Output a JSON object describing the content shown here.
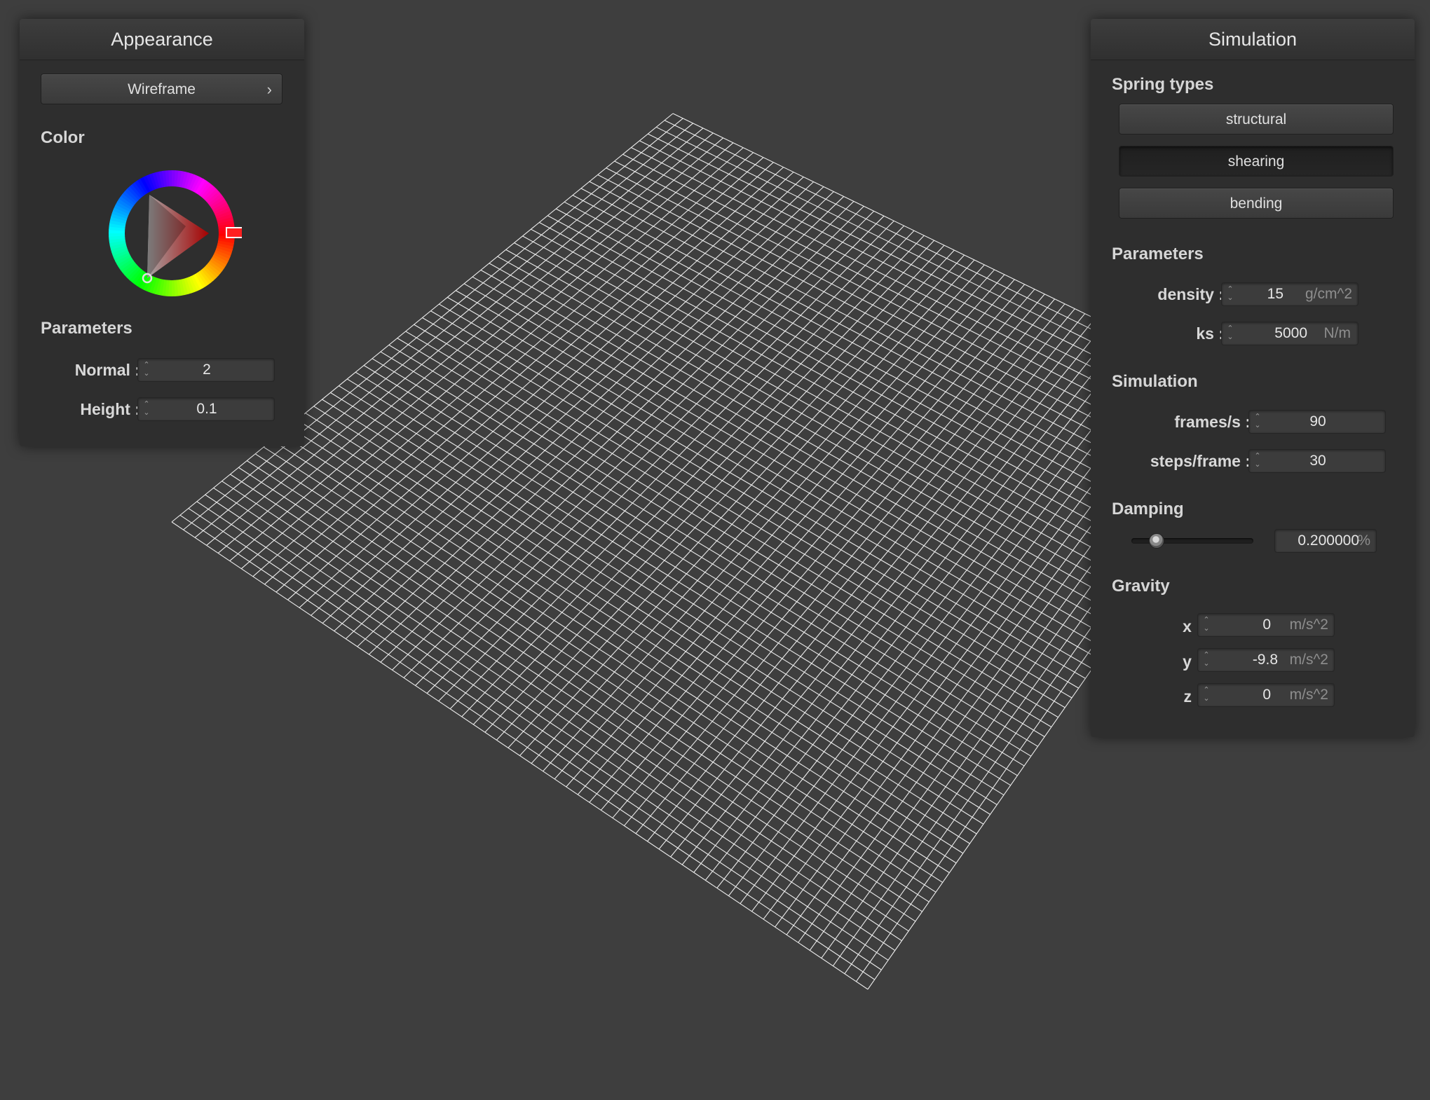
{
  "appearance": {
    "title": "Appearance",
    "shader_button": "Wireframe",
    "color_title": "Color",
    "color_value": "#ff0000",
    "parameters_title": "Parameters",
    "normal": {
      "label": "Normal :",
      "value": "2"
    },
    "height": {
      "label": "Height :",
      "value": "0.1"
    }
  },
  "simulation": {
    "title": "Simulation",
    "spring_types_title": "Spring types",
    "spring_types": [
      {
        "label": "structural",
        "pressed": false
      },
      {
        "label": "shearing",
        "pressed": true
      },
      {
        "label": "bending",
        "pressed": false
      }
    ],
    "parameters_title": "Parameters",
    "density": {
      "label": "density :",
      "value": "15",
      "unit": "g/cm^2"
    },
    "ks": {
      "label": "ks :",
      "value": "5000",
      "unit": "N/m"
    },
    "simulation_title": "Simulation",
    "frames_per_s": {
      "label": "frames/s :",
      "value": "90"
    },
    "steps_per_frame": {
      "label": "steps/frame :",
      "value": "30"
    },
    "damping_title": "Damping",
    "damping": {
      "value": "0.200000",
      "unit": "%",
      "fraction": 0.2
    },
    "gravity_title": "Gravity",
    "gravity": [
      {
        "label": "x :",
        "value": "0",
        "unit": "m/s^2"
      },
      {
        "label": "y :",
        "value": "-9.8",
        "unit": "m/s^2"
      },
      {
        "label": "z :",
        "value": "0",
        "unit": "m/s^2"
      }
    ]
  },
  "viewport": {
    "mesh_color": "#ffffff",
    "background": "#3e3e3e"
  }
}
